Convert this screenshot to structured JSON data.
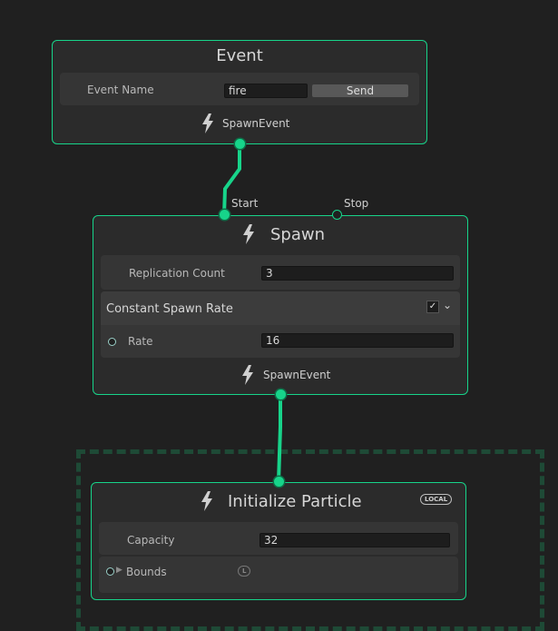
{
  "event_node": {
    "title": "Event",
    "field_label": "Event Name",
    "field_value": "fire",
    "send_label": "Send",
    "output_label": "SpawnEvent"
  },
  "spawn_node": {
    "title": "Spawn",
    "start_label": "Start",
    "stop_label": "Stop",
    "replication_label": "Replication Count",
    "replication_value": "3",
    "block_title": "Constant Spawn Rate",
    "block_enabled": true,
    "rate_label": "Rate",
    "rate_value": "16",
    "output_label": "SpawnEvent"
  },
  "init_node": {
    "title": "Initialize Particle",
    "badge": "LOCAL",
    "capacity_label": "Capacity",
    "capacity_value": "32",
    "bounds_label": "Bounds",
    "bounds_badge": "L"
  },
  "colors": {
    "accent": "#17d48a",
    "background": "#202020",
    "node": "#2b2b2b"
  },
  "icons": [
    "lightning-icon",
    "checkbox-icon",
    "chevron-down-icon",
    "expand-arrow-icon"
  ]
}
